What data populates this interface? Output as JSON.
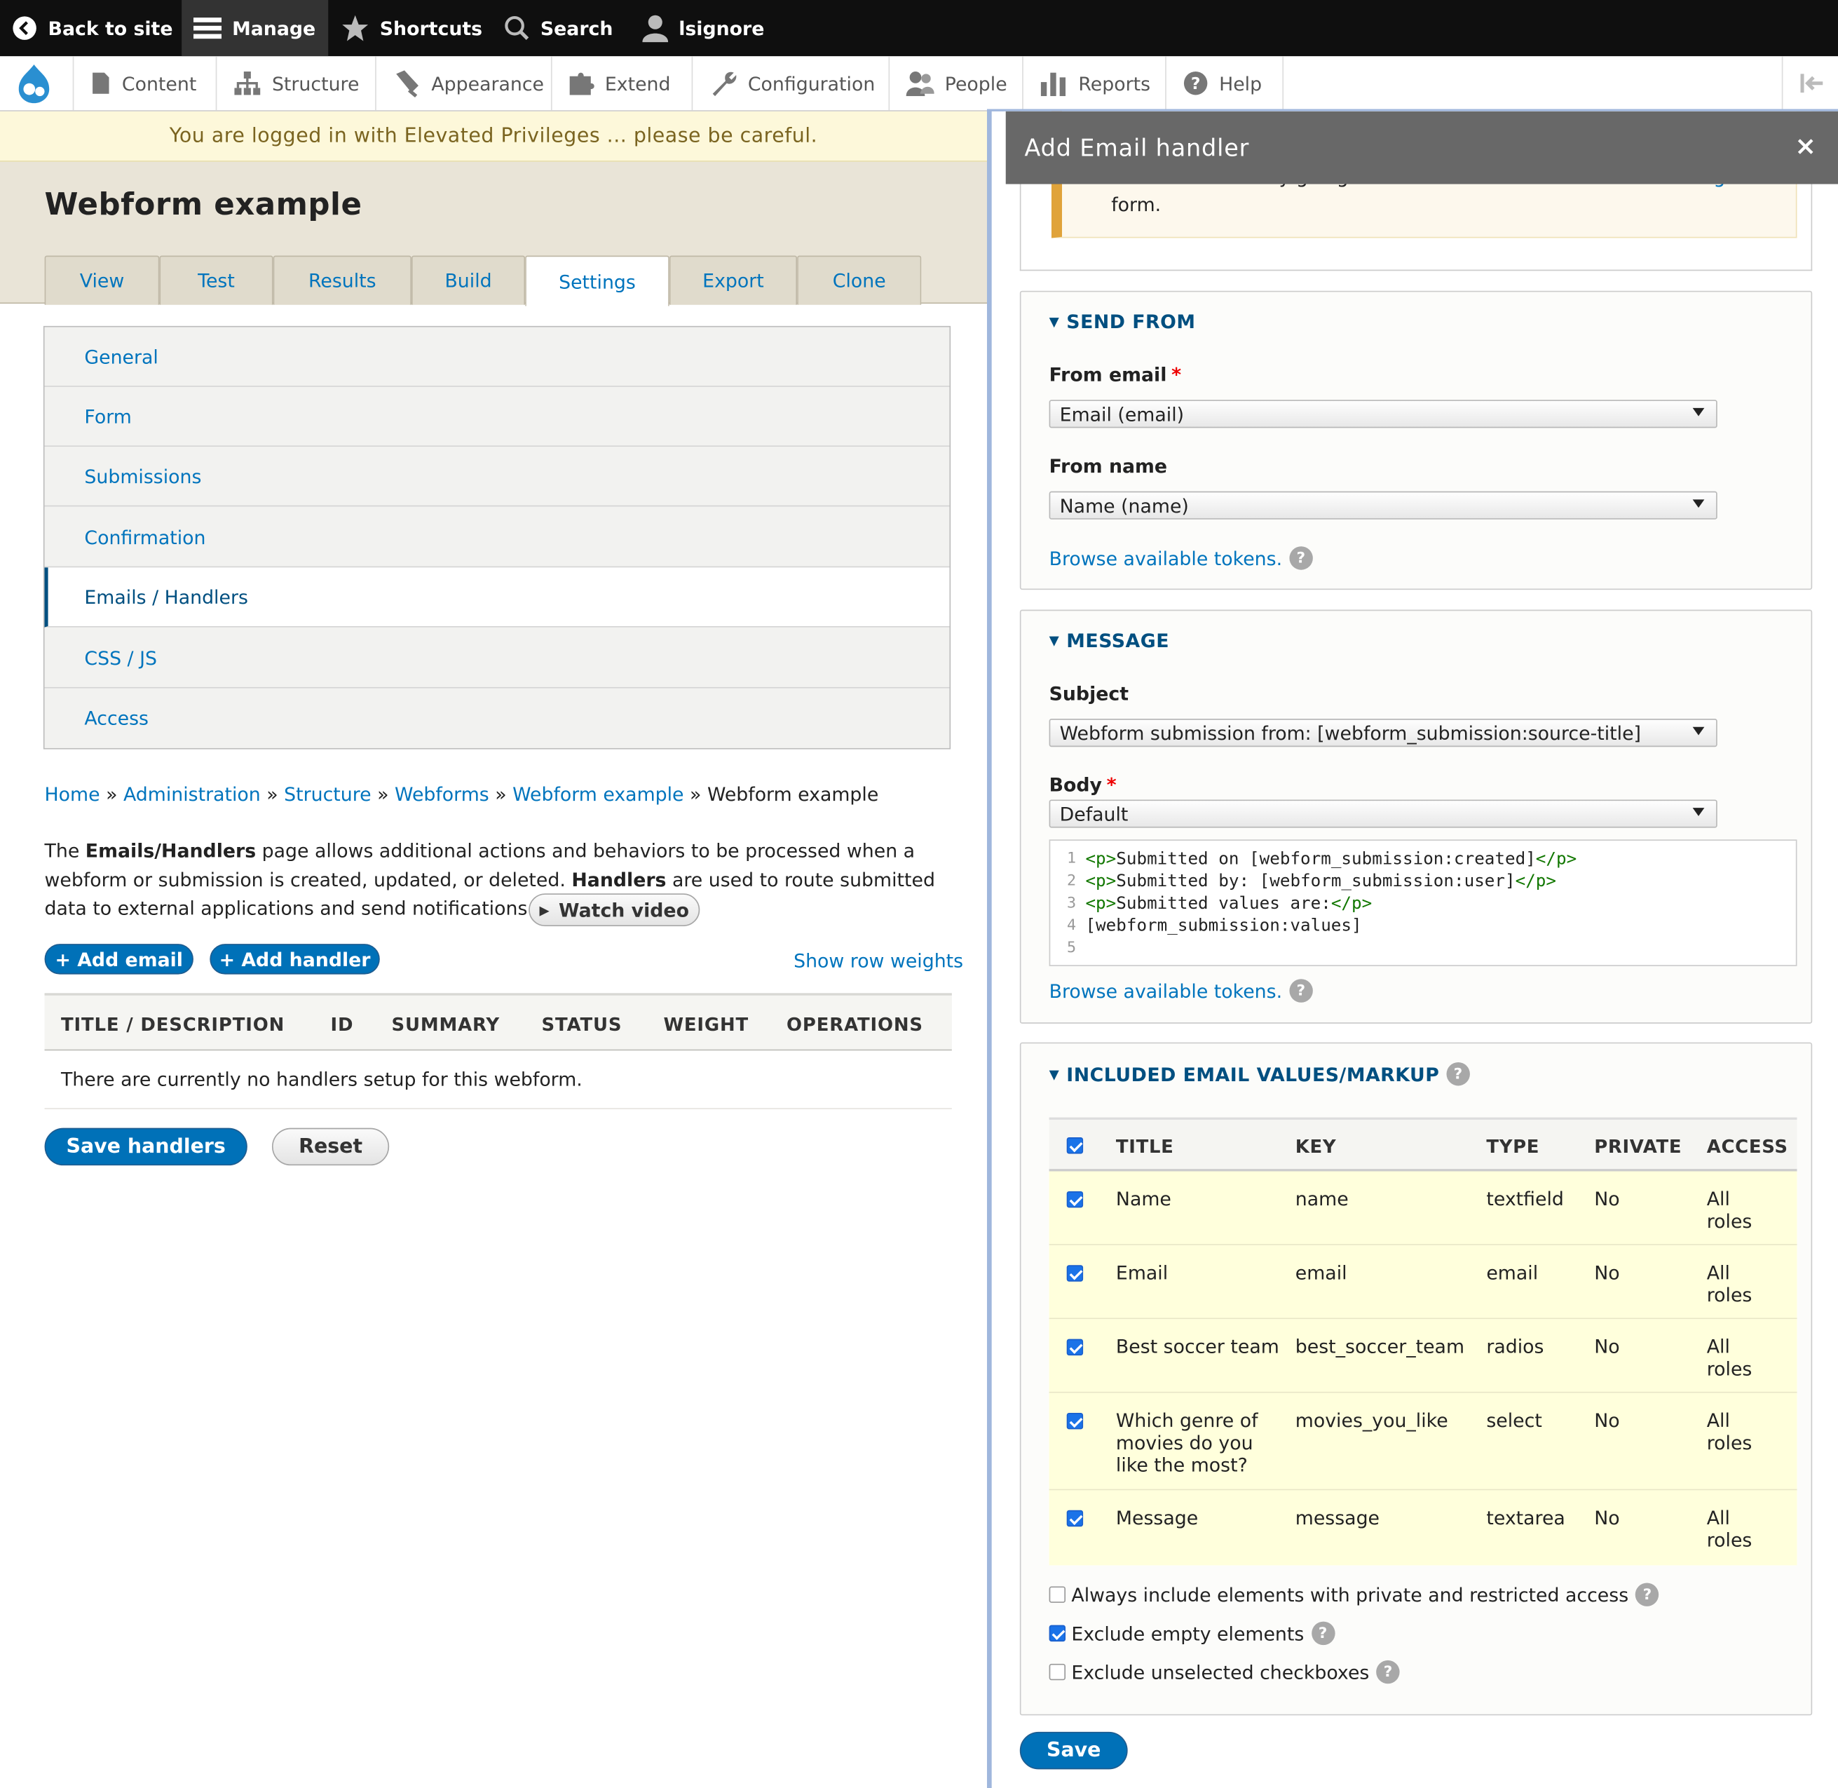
{
  "toolbar": {
    "back": "Back to site",
    "manage": "Manage",
    "shortcuts": "Shortcuts",
    "search": "Search",
    "user": "lsignore"
  },
  "tray": {
    "content": "Content",
    "structure": "Structure",
    "appearance": "Appearance",
    "extend": "Extend",
    "configuration": "Configuration",
    "people": "People",
    "reports": "Reports",
    "help": "Help"
  },
  "warning": "You are logged in with Elevated Privileges ... please be careful.",
  "page_title": "Webform example",
  "tabs": [
    "View",
    "Test",
    "Results",
    "Build",
    "Settings",
    "Export",
    "Clone"
  ],
  "vertical_tabs": [
    "General",
    "Form",
    "Submissions",
    "Confirmation",
    "Emails / Handlers",
    "CSS / JS",
    "Access"
  ],
  "breadcrumb": {
    "home": "Home",
    "administration": "Administration",
    "structure": "Structure",
    "webforms": "Webforms",
    "webform_example": "Webform example",
    "current": "Webform example",
    "sep": "»"
  },
  "description": {
    "p1": "The ",
    "b1": "Emails/Handlers",
    "p2": " page allows additional actions and behaviors to be processed when a webform or submission is created, updated, or deleted. ",
    "b2": "Handlers",
    "p3": " are used to route submitted data to external applications and send notifications & confirmations.",
    "watch": "Watch video"
  },
  "buttons": {
    "add_email": "+ Add email",
    "add_handler": "+ Add handler",
    "show_weights": "Show row weights",
    "save_handlers": "Save handlers",
    "reset": "Reset"
  },
  "handlers_table": {
    "headers": [
      "TITLE / DESCRIPTION",
      "ID",
      "SUMMARY",
      "STATUS",
      "WEIGHT",
      "OPERATIONS"
    ],
    "empty": "There are currently no handlers setup for this webform."
  },
  "dialog": {
    "title": "Add Email handler",
    "close": "×",
    "notice_line1": "webform emails by going to the webform module's",
    "notice_link": "admin settings",
    "notice_line2": "form.",
    "send_from": {
      "legend": "SEND FROM",
      "from_email_label": "From email",
      "from_email_value": "Email (email)",
      "from_name_label": "From name",
      "from_name_value": "Name (name)",
      "tokens": "Browse available tokens."
    },
    "message": {
      "legend": "MESSAGE",
      "subject_label": "Subject",
      "subject_value": "Webform submission from: [webform_submission:source-title]",
      "body_label": "Body",
      "body_value": "Default",
      "code_lines": [
        {
          "n": "1",
          "open": "<p>",
          "text": "Submitted on [webform_submission:created]",
          "close": "</p>"
        },
        {
          "n": "2",
          "open": "<p>",
          "text": "Submitted by: [webform_submission:user]",
          "close": "</p>"
        },
        {
          "n": "3",
          "open": "<p>",
          "text": "Submitted values are:",
          "close": "</p>"
        },
        {
          "n": "4",
          "open": "",
          "text": "[webform_submission:values]",
          "close": ""
        },
        {
          "n": "5",
          "open": "",
          "text": "",
          "close": ""
        }
      ],
      "tokens": "Browse available tokens."
    },
    "included": {
      "legend": "INCLUDED EMAIL VALUES/MARKUP",
      "headers": [
        "TITLE",
        "KEY",
        "TYPE",
        "PRIVATE",
        "ACCESS"
      ],
      "rows": [
        {
          "title": "Name",
          "key": "name",
          "type": "textfield",
          "private": "No",
          "access": "All roles"
        },
        {
          "title": "Email",
          "key": "email",
          "type": "email",
          "private": "No",
          "access": "All roles"
        },
        {
          "title": "Best soccer team",
          "key": "best_soccer_team",
          "type": "radios",
          "private": "No",
          "access": "All roles"
        },
        {
          "title": "Which genre of movies do you like the most?",
          "key": "movies_you_like",
          "type": "select",
          "private": "No",
          "access": "All roles"
        },
        {
          "title": "Message",
          "key": "message",
          "type": "textarea",
          "private": "No",
          "access": "All roles"
        }
      ],
      "options": [
        {
          "label": "Always include elements with private and restricted access",
          "checked": false
        },
        {
          "label": "Exclude empty elements",
          "checked": true
        },
        {
          "label": "Exclude unselected checkboxes",
          "checked": false
        }
      ]
    },
    "save": "Save"
  },
  "help_glyph": "?",
  "colors": {
    "link": "#0074bd",
    "primary_button": "#0071b8",
    "toolbar": "#0f0f0f",
    "warning_bg": "#fdf8da",
    "row_highlight": "#ffffdc"
  }
}
